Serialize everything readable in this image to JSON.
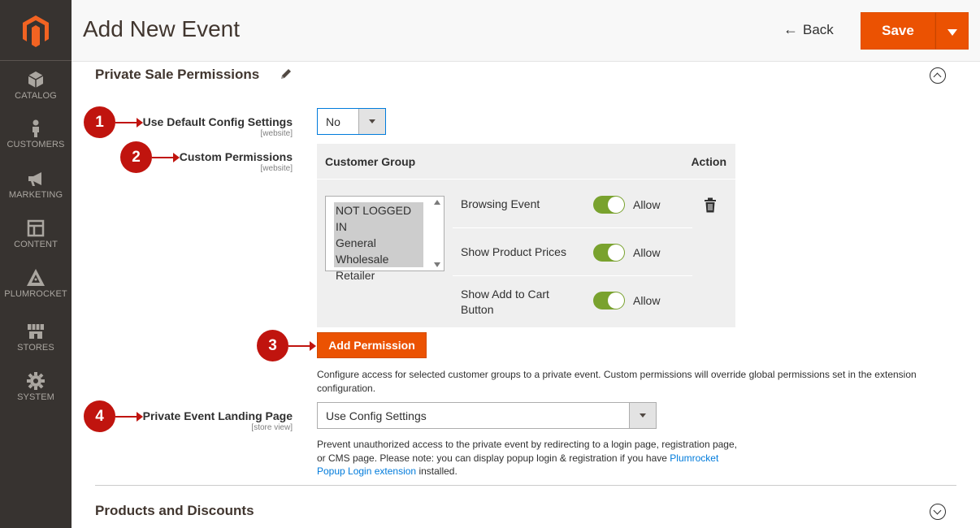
{
  "page": {
    "title": "Add New Event"
  },
  "header": {
    "back_label": "Back",
    "save_label": "Save"
  },
  "sidebar": {
    "items": [
      {
        "label": "CATALOG",
        "icon": "cube-icon"
      },
      {
        "label": "CUSTOMERS",
        "icon": "person-icon"
      },
      {
        "label": "MARKETING",
        "icon": "megaphone-icon"
      },
      {
        "label": "CONTENT",
        "icon": "layout-icon"
      },
      {
        "label": "PLUMROCKET",
        "icon": "plumrocket-icon"
      },
      {
        "label": "STORES",
        "icon": "storefront-icon"
      },
      {
        "label": "SYSTEM",
        "icon": "gear-icon"
      }
    ]
  },
  "section1": {
    "title": "Private Sale Permissions"
  },
  "section2": {
    "title": "Products and Discounts"
  },
  "markers": [
    "1",
    "2",
    "3",
    "4"
  ],
  "fields": {
    "use_default": {
      "label": "Use Default Config Settings",
      "scope": "[website]",
      "value": "No"
    },
    "custom_permissions": {
      "label": "Custom Permissions",
      "scope": "[website]"
    },
    "landing_page": {
      "label": "Private Event Landing Page",
      "scope": "[store view]",
      "value": "Use Config Settings"
    }
  },
  "grid": {
    "header_group": "Customer Group",
    "header_action": "Action",
    "groups": [
      "NOT LOGGED IN",
      "General",
      "Wholesale",
      "Retailer"
    ],
    "permissions": [
      {
        "name": "Browsing Event",
        "state": "Allow"
      },
      {
        "name": "Show Product Prices",
        "state": "Allow"
      },
      {
        "name": "Show Add to Cart Button",
        "state": "Allow"
      }
    ]
  },
  "add_permission": {
    "label": "Add Permission"
  },
  "notes": {
    "permissions": "Configure access for selected customer groups to a private event. Custom permissions will override global permissions set in the extension configuration.",
    "landing_line1": "Prevent unauthorized access to the private event by redirecting to a login page, registration page, or CMS page. Please note: you can display popup login & registration if you have",
    "landing_link": "Plumrocket Popup Login extension",
    "landing_suffix": " installed."
  },
  "colors": {
    "accent": "#eb5202",
    "sidebar": "#373330",
    "toggle_on": "#79a22e",
    "marker": "#c0140e",
    "link": "#007bdb"
  }
}
